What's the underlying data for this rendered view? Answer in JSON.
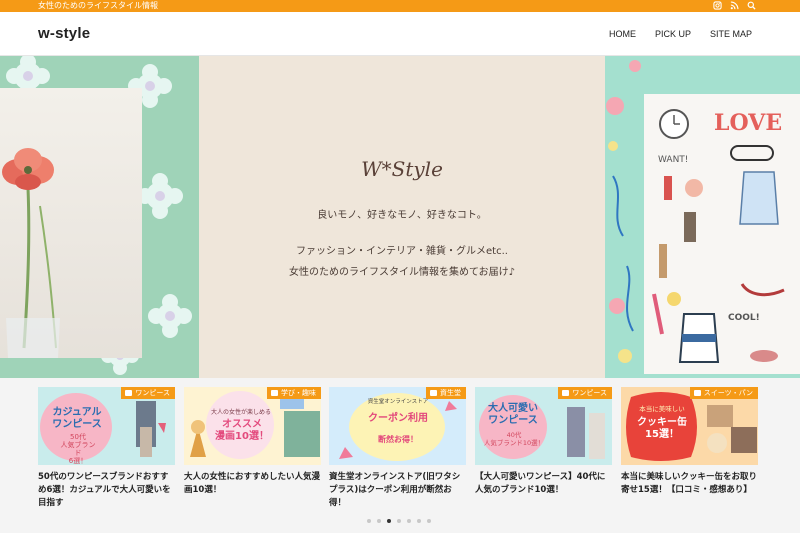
{
  "topbar": {
    "tagline": "女性のためのライフスタイル情報",
    "icons": [
      "instagram-icon",
      "rss-icon",
      "search-icon"
    ]
  },
  "header": {
    "logo": "w-style",
    "nav": [
      {
        "label": "HOME"
      },
      {
        "label": "PICK UP"
      },
      {
        "label": "SITE MAP"
      }
    ]
  },
  "hero": {
    "brand": "W*Style",
    "line1": "良いモノ、好きなモノ、好きなコト。",
    "line2": "ファッション・インテリア・雑貨・グルメetc..",
    "line3": "女性のためのライフスタイル情報を集めてお届け♪",
    "illustration_text": {
      "love": "LOVE",
      "want": "WANT!",
      "cool": "COOL!"
    }
  },
  "carousel": {
    "cards": [
      {
        "category": "ワンピース",
        "title": "50代のワンピースブランドおすすめ6選！カジュアルで大人可愛いを目指す",
        "thumb_lines": [
          "カジュアル",
          "ワンピース",
          "50代",
          "人気ブランド",
          "6選！"
        ]
      },
      {
        "category": "学び・趣味",
        "title": "大人の女性におすすめしたい人気漫画10選！",
        "thumb_lines": [
          "大人の女性が楽しめる",
          "オススメ",
          "漫画10選！"
        ]
      },
      {
        "category": "資生堂",
        "title": "資生堂オンラインストア(旧ワタシプラス)はクーポン利用が断然お得！",
        "thumb_lines": [
          "資生堂オンラインストア",
          "クーポン利用",
          "断然お得！"
        ]
      },
      {
        "category": "ワンピース",
        "title": "【大人可愛いワンピース】40代に人気のブランド10選！",
        "thumb_lines": [
          "大人可愛い",
          "ワンピース",
          "40代",
          "人気ブランド10選！"
        ]
      },
      {
        "category": "スイーツ・パン",
        "title": "本当に美味しいクッキー缶をお取り寄せ15選！【口コミ・感想あり】",
        "thumb_lines": [
          "本当に美味しい",
          "クッキー缶",
          "15選！"
        ]
      }
    ],
    "dots": 7,
    "active_dot": 2
  },
  "colors": {
    "accent": "#f59a16",
    "hero_green": "#97d2bf",
    "hero_cream": "#efe6da"
  }
}
